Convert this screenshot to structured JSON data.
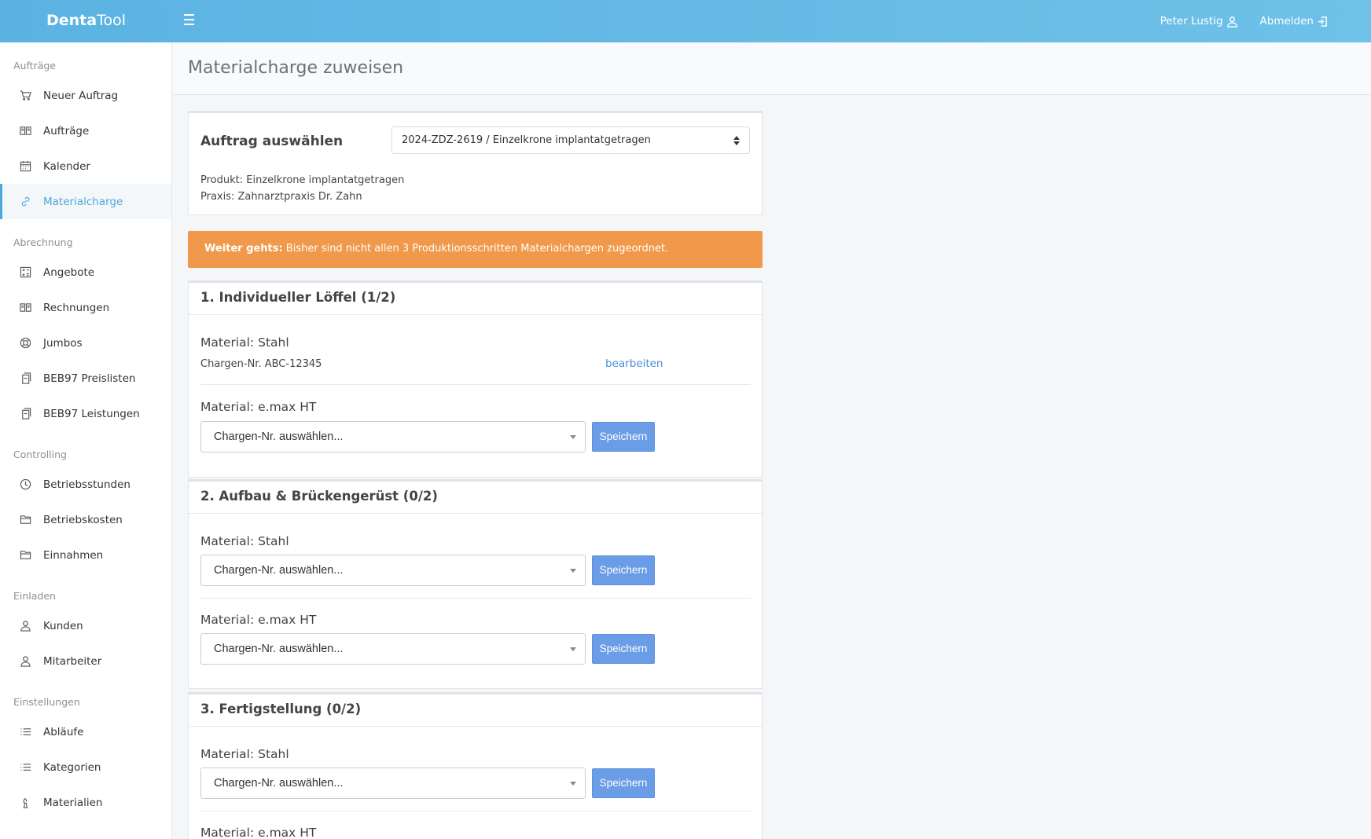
{
  "app": {
    "brand_part1": "Denta",
    "brand_part2": "Tool"
  },
  "topbar": {
    "user_name": "Peter Lustig",
    "logout_label": "Abmelden"
  },
  "sidebar": {
    "sections": [
      {
        "title": "Aufträge",
        "items": [
          {
            "label": "Neuer Auftrag",
            "icon": "cart-icon"
          },
          {
            "label": "Aufträge",
            "icon": "book-icon"
          },
          {
            "label": "Kalender",
            "icon": "calendar-icon"
          },
          {
            "label": "Materialcharge",
            "icon": "link-icon",
            "active": true
          }
        ]
      },
      {
        "title": "Abrechnung",
        "items": [
          {
            "label": "Angebote",
            "icon": "calculator-icon"
          },
          {
            "label": "Rechnungen",
            "icon": "book-icon"
          },
          {
            "label": "Jumbos",
            "icon": "lifebuoy-icon"
          },
          {
            "label": "BEB97 Preislisten",
            "icon": "copy-icon"
          },
          {
            "label": "BEB97 Leistungen",
            "icon": "copy-icon"
          }
        ]
      },
      {
        "title": "Controlling",
        "items": [
          {
            "label": "Betriebsstunden",
            "icon": "clock-icon"
          },
          {
            "label": "Betriebskosten",
            "icon": "folder-icon"
          },
          {
            "label": "Einnahmen",
            "icon": "folder-icon"
          }
        ]
      },
      {
        "title": "Einladen",
        "items": [
          {
            "label": "Kunden",
            "icon": "user-icon"
          },
          {
            "label": "Mitarbeiter",
            "icon": "user-icon"
          }
        ]
      },
      {
        "title": "Einstellungen",
        "items": [
          {
            "label": "Abläufe",
            "icon": "list-icon"
          },
          {
            "label": "Kategorien",
            "icon": "list-icon"
          },
          {
            "label": "Materialien",
            "icon": "chess-icon"
          }
        ]
      }
    ]
  },
  "page": {
    "title": "Materialcharge zuweisen"
  },
  "order": {
    "label": "Auftrag auswählen",
    "selected": "2024-ZDZ-2619 / Einzelkrone implantatgetragen",
    "product": "Produkt: Einzelkrone implantatgetragen",
    "practice": "Praxis: Zahnarztpraxis Dr. Zahn"
  },
  "alert": {
    "strong": "Weiter gehts:",
    "text": " Bisher sind nicht allen 3 Produktionsschritten Materialchargen zugeordnet."
  },
  "common": {
    "select_placeholder": "Chargen-Nr. auswählen...",
    "save_label": "Speichern",
    "edit_label": "bearbeiten"
  },
  "steps": [
    {
      "title": "1. Individueller Löffel (1/2)",
      "materials": [
        {
          "name": "Material: Stahl",
          "charge": "Chargen-Nr. ABC-12345"
        },
        {
          "name": "Material: e.max HT"
        }
      ]
    },
    {
      "title": "2. Aufbau & Brückengerüst (0/2)",
      "materials": [
        {
          "name": "Material: Stahl"
        },
        {
          "name": "Material: e.max HT"
        }
      ]
    },
    {
      "title": "3. Fertigstellung (0/2)",
      "materials": [
        {
          "name": "Material: Stahl"
        },
        {
          "name": "Material: e.max HT"
        }
      ]
    }
  ]
}
